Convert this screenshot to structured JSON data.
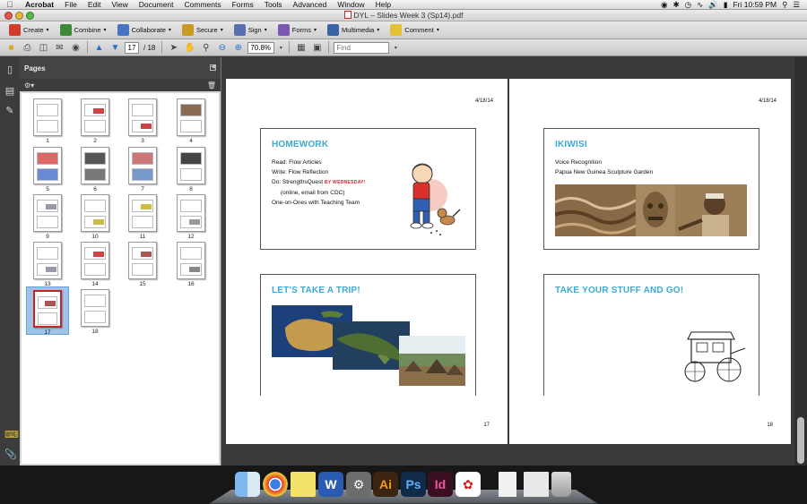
{
  "menubar": {
    "app": "Acrobat",
    "menus": [
      "File",
      "Edit",
      "View",
      "Document",
      "Comments",
      "Forms",
      "Tools",
      "Advanced",
      "Window",
      "Help"
    ],
    "clock": "Fri 10:59 PM"
  },
  "window": {
    "title": "DYL – Slides Week 3 (Sp14).pdf"
  },
  "tasks": [
    {
      "label": "Create",
      "color": "#d23b2c"
    },
    {
      "label": "Combine",
      "color": "#3c8a3a"
    },
    {
      "label": "Collaborate",
      "color": "#4a73c4"
    },
    {
      "label": "Secure",
      "color": "#c99a22"
    },
    {
      "label": "Sign",
      "color": "#5a6fb0"
    },
    {
      "label": "Forms",
      "color": "#7a58b4"
    },
    {
      "label": "Multimedia",
      "color": "#3a63a8"
    },
    {
      "label": "Comment",
      "color": "#e2c233"
    }
  ],
  "navbar": {
    "page_current": "17",
    "page_total": "/ 18",
    "zoom": "70.8%",
    "find_placeholder": "Find"
  },
  "pages_panel": {
    "title": "Pages",
    "thumbnails": [
      "1",
      "2",
      "3",
      "4",
      "5",
      "6",
      "7",
      "8",
      "9",
      "10",
      "11",
      "12",
      "13",
      "14",
      "15",
      "16",
      "17",
      "18"
    ],
    "selected": "17"
  },
  "page17": {
    "date": "4/18/14",
    "number": "17",
    "slide_top": {
      "title": "HOMEWORK",
      "line1": "Read: Flow Articles",
      "line2": "Write: Flow Reflection",
      "line3_start": "Do: StrengthsQuest",
      "line3_accent": "BY WEDNESDAY",
      "line3_end": "!",
      "line4": "(online, email from CDC)",
      "line5": "One-on-Ones with Teaching Team"
    },
    "slide_bottom": {
      "title": "LET'S TAKE A TRIP!"
    }
  },
  "page18": {
    "date": "4/18/14",
    "number": "18",
    "slide_top": {
      "title": "IKIWISI",
      "line1": "Voice Recognition",
      "line2": "Papua New Guinea Sculpture Garden"
    },
    "slide_bottom": {
      "title": "TAKE YOUR STUFF AND GO!"
    }
  },
  "colors": {
    "slide_title": "#3aaad5",
    "accent_red": "#d4232a",
    "selection": "#9ec3e8"
  },
  "dock": {
    "apps": [
      "finder-icon",
      "chrome-icon",
      "stickies-icon",
      "word-icon",
      "preview-icon",
      "illustrator-icon",
      "photoshop-icon",
      "indesign-icon",
      "acrobat-icon",
      "document-icon",
      "image-icon",
      "trash-icon"
    ],
    "labels": {
      "word": "W",
      "illustrator": "Ai",
      "photoshop": "Ps",
      "indesign": "Id"
    }
  }
}
